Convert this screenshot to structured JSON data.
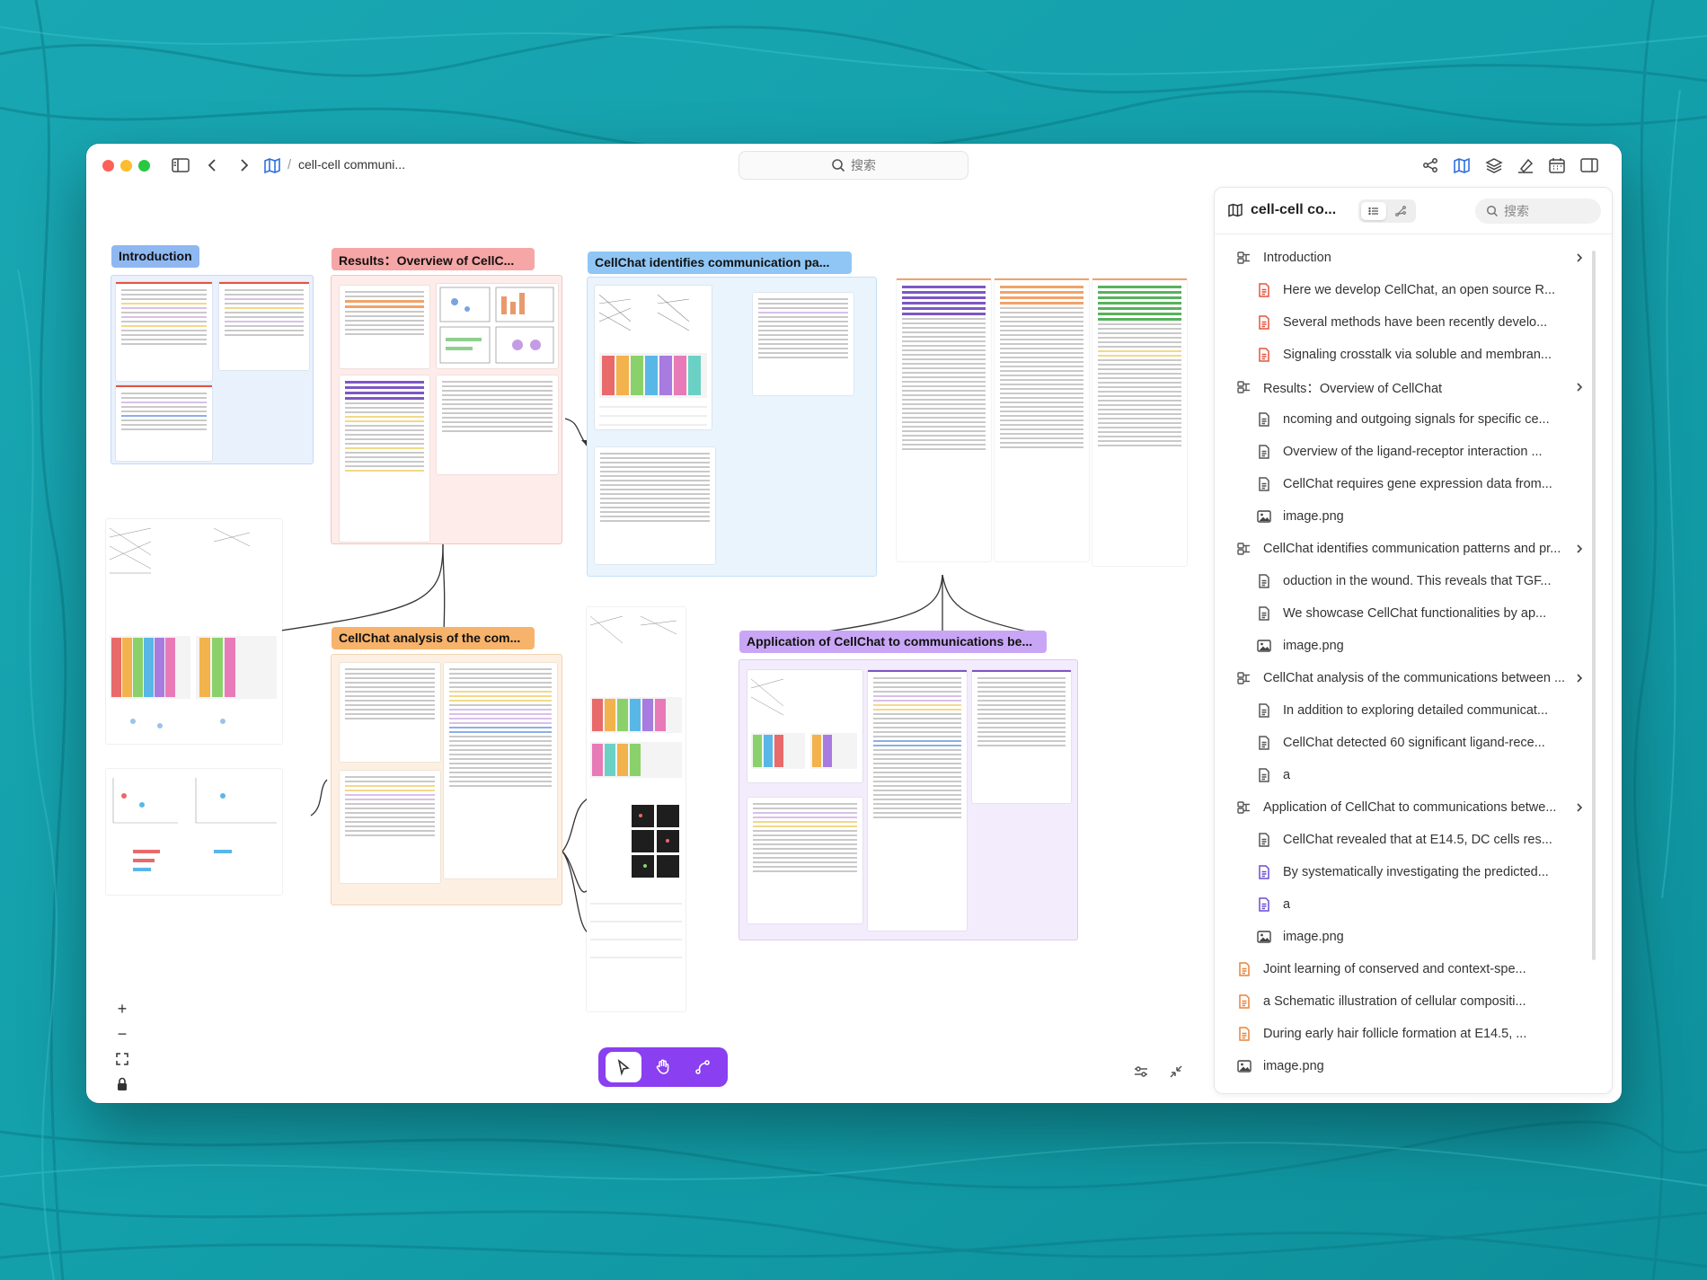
{
  "app": {
    "breadcrumb_separator": "/",
    "doc_title": "cell-cell communi...",
    "search_placeholder": "搜索"
  },
  "canvas": {
    "groups": [
      {
        "id": "intro",
        "label": "Introduction",
        "color": "#8fb8f2"
      },
      {
        "id": "results",
        "label": "Results：Overview of CellC...",
        "color": "#f6a6a6"
      },
      {
        "id": "identifies",
        "label": "CellChat identifies communication pa...",
        "color": "#8fc6f5"
      },
      {
        "id": "analysis",
        "label": "CellChat analysis of the com...",
        "color": "#f7b36b"
      },
      {
        "id": "application",
        "label": "Application of CellChat to communications be...",
        "color": "#c9a6f5"
      }
    ],
    "tools": [
      {
        "name": "select-tool",
        "active": true
      },
      {
        "name": "hand-tool",
        "active": false
      },
      {
        "name": "connector-tool",
        "active": false
      }
    ],
    "zoom_controls": [
      "+",
      "−"
    ]
  },
  "panel": {
    "title": "cell-cell co...",
    "search_placeholder": "搜索",
    "outline": [
      {
        "type": "section",
        "label": "Introduction",
        "indent": 0,
        "expandable": true
      },
      {
        "type": "doc",
        "label": "Here we develop CellChat, an open source R...",
        "indent": 1,
        "color": "#e5533d"
      },
      {
        "type": "doc",
        "label": "Several methods have been recently develo...",
        "indent": 1,
        "color": "#e5533d"
      },
      {
        "type": "doc",
        "label": "Signaling crosstalk via soluble and membran...",
        "indent": 1,
        "color": "#e5533d"
      },
      {
        "type": "section",
        "label": "Results：Overview of CellChat",
        "indent": 0,
        "expandable": true
      },
      {
        "type": "doc",
        "label": "ncoming and outgoing signals for specific ce...",
        "indent": 1,
        "color": "#555555"
      },
      {
        "type": "doc",
        "label": "Overview of the ligand-receptor interaction ...",
        "indent": 1,
        "color": "#555555"
      },
      {
        "type": "doc",
        "label": "CellChat requires gene expression data from...",
        "indent": 1,
        "color": "#555555"
      },
      {
        "type": "image",
        "label": "image.png",
        "indent": 1,
        "color": "#555555"
      },
      {
        "type": "section",
        "label": "CellChat identifies communication patterns and pr...",
        "indent": 0,
        "expandable": true
      },
      {
        "type": "doc",
        "label": "oduction in the wound. This reveals that TGF...",
        "indent": 1,
        "color": "#555555"
      },
      {
        "type": "doc",
        "label": "We showcase CellChat functionalities by ap...",
        "indent": 1,
        "color": "#555555"
      },
      {
        "type": "image",
        "label": "image.png",
        "indent": 1,
        "color": "#555555"
      },
      {
        "type": "section",
        "label": "CellChat analysis of the communications between ...",
        "indent": 0,
        "expandable": true
      },
      {
        "type": "doc",
        "label": "In addition to exploring detailed communicat...",
        "indent": 1,
        "color": "#555555"
      },
      {
        "type": "doc",
        "label": "CellChat detected 60 significant ligand-rece...",
        "indent": 1,
        "color": "#555555"
      },
      {
        "type": "doc",
        "label": "a",
        "indent": 1,
        "color": "#555555"
      },
      {
        "type": "section",
        "label": "Application of CellChat to communications betwe...",
        "indent": 0,
        "expandable": true
      },
      {
        "type": "doc",
        "label": "CellChat revealed that at E14.5, DC cells res...",
        "indent": 1,
        "color": "#555555"
      },
      {
        "type": "doc",
        "label": "By systematically investigating the predicted...",
        "indent": 1,
        "color": "#6a4fd0"
      },
      {
        "type": "doc",
        "label": "a",
        "indent": 1,
        "color": "#6a4fd0"
      },
      {
        "type": "image",
        "label": "image.png",
        "indent": 1,
        "color": "#555555"
      },
      {
        "type": "doc",
        "label": "Joint learning of conserved and context-spe...",
        "indent": 0,
        "color": "#e8843c"
      },
      {
        "type": "doc",
        "label": "a Schematic illustration of cellular compositi...",
        "indent": 0,
        "color": "#e8843c"
      },
      {
        "type": "doc",
        "label": "During early hair follicle formation at E14.5, ...",
        "indent": 0,
        "color": "#e8843c"
      },
      {
        "type": "image",
        "label": "image.png",
        "indent": 0,
        "color": "#555555"
      }
    ]
  }
}
